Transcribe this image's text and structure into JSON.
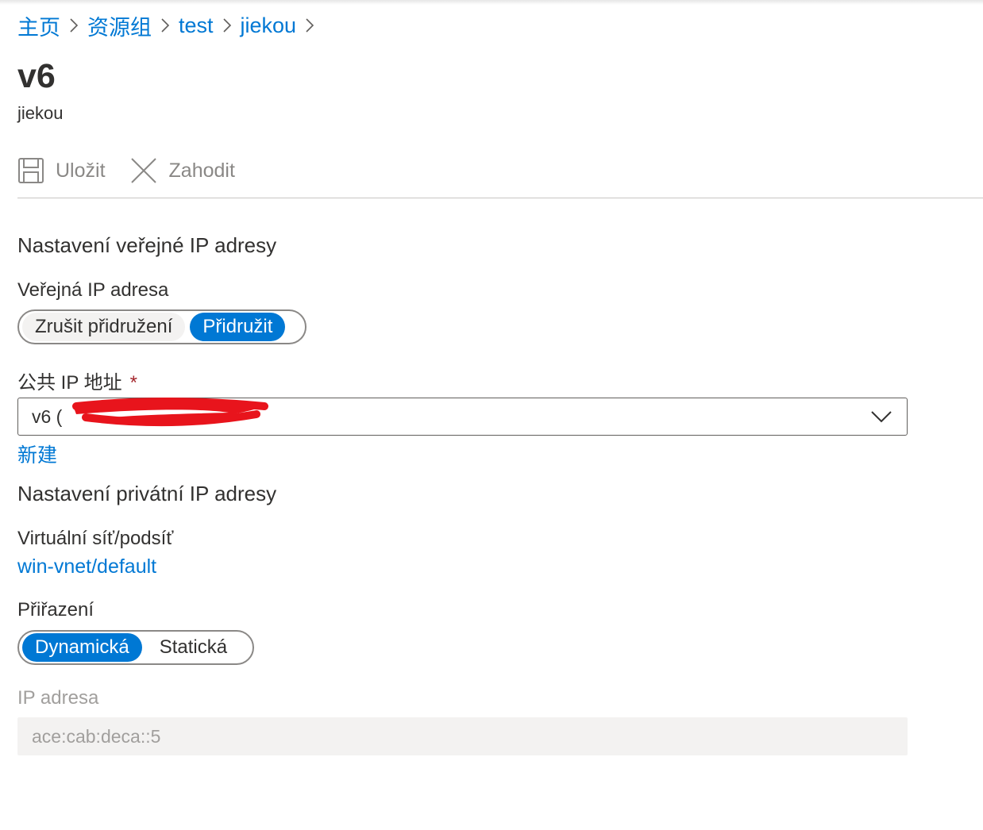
{
  "breadcrumb": {
    "items": [
      "主页",
      "资源组",
      "test",
      "jiekou"
    ]
  },
  "header": {
    "title": "v6",
    "subtitle": "jiekou"
  },
  "toolbar": {
    "save_label": "Uložit",
    "discard_label": "Zahodit",
    "save_icon": "save-icon",
    "discard_icon": "close-icon"
  },
  "public_ip": {
    "section_title": "Nastavení veřejné IP adresy",
    "field_label": "Veřejná IP adresa",
    "options": [
      "Zrušit přidružení",
      "Přidružit"
    ],
    "selected": "Přidružit",
    "address_label": "公共 IP 地址",
    "required_mark": "*",
    "address_value": "v6 (",
    "address_value_redacted": true,
    "create_new_link": "新建"
  },
  "private_ip": {
    "section_title": "Nastavení privátní IP adresy",
    "vnet_label": "Virtuální síť/podsíť",
    "vnet_value": "win-vnet/default",
    "assignment_label": "Přiřazení",
    "assignment_options": [
      "Dynamická",
      "Statická"
    ],
    "assignment_selected": "Dynamická",
    "ip_label": "IP adresa",
    "ip_value": "ace:cab:deca::5"
  },
  "colors": {
    "accent": "#0078d4",
    "text": "#323130",
    "disabled_text": "#a19f9d",
    "required": "#a4262c",
    "redaction": "#e8141c"
  }
}
